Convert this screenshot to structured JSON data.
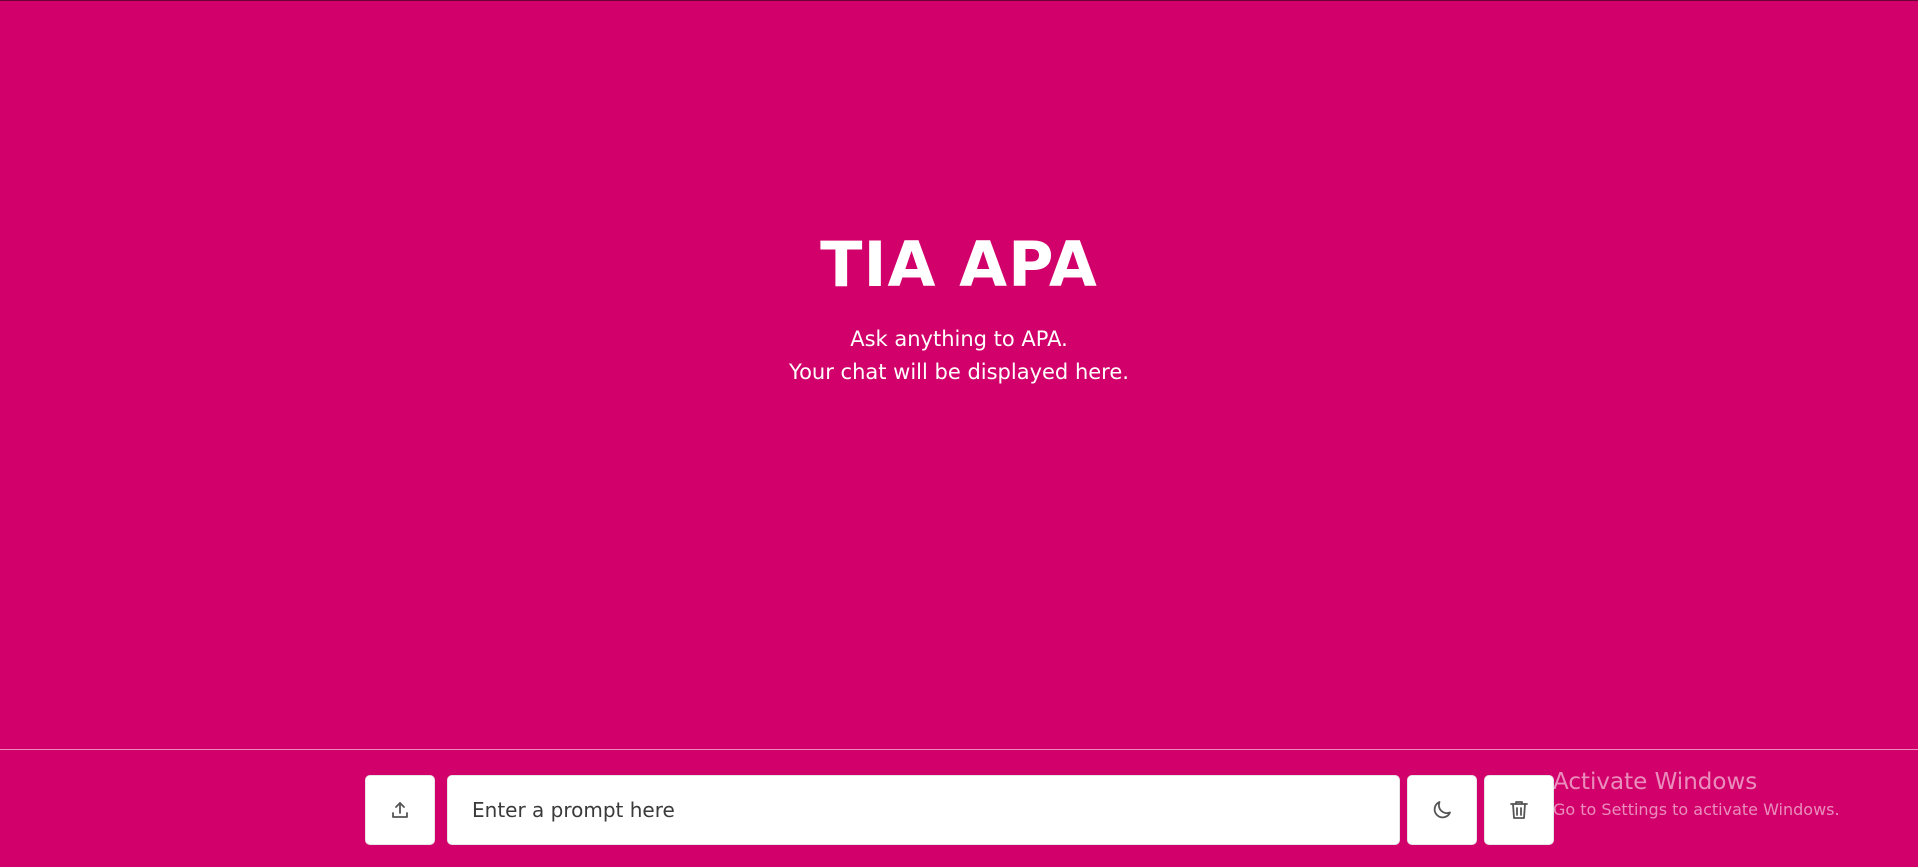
{
  "colors": {
    "background": "#d1006a",
    "text": "#ffffff",
    "button_bg": "#ffffff",
    "icon": "#555555"
  },
  "hero": {
    "title": "TIA APA",
    "line1": "Ask anything to APA.",
    "line2": "Your chat will be displayed here."
  },
  "composer": {
    "upload_icon": "upload-icon",
    "prompt_placeholder": "Enter a prompt here",
    "prompt_value": "",
    "theme_icon": "moon-icon",
    "delete_icon": "trash-icon"
  },
  "watermark": {
    "title": "Activate Windows",
    "subtitle": "Go to Settings to activate Windows."
  }
}
